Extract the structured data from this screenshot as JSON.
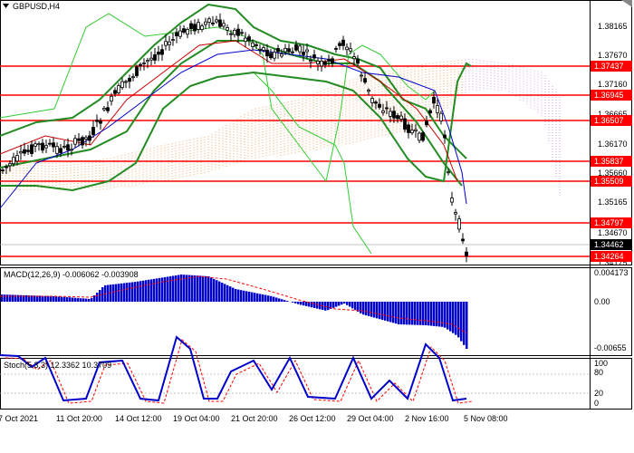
{
  "main_panel": {
    "symbol_title": "GBPUSD,H4",
    "price_labels": [
      "1.38165",
      "1.37670",
      "1.37160",
      "1.36665",
      "1.36170",
      "1.35660",
      "1.35165",
      "1.34670",
      "1.34175"
    ],
    "level_badges": [
      "1.37437",
      "1.36945",
      "1.36507",
      "1.35837",
      "1.35509",
      "1.34797",
      "1.34264"
    ],
    "current_price": "1.34462"
  },
  "macd_panel": {
    "title": "MACD(12,26,9) -0.006062 -0.003908",
    "labels": [
      "0.004173",
      "0.00",
      "-0.00655"
    ],
    "histogram_color": "#0000cc",
    "signal_color": "#ff0000"
  },
  "stoch_panel": {
    "title": "Stoch(5,3,3) 12.3362 10.3709",
    "labels": [
      "100",
      "80",
      "20",
      "0"
    ],
    "main_color": "#0000cc",
    "signal_color": "#ff0000"
  },
  "time_axis": {
    "labels": [
      "7 Oct 2021",
      "11 Oct 20:00",
      "14 Oct 12:00",
      "19 Oct 04:00",
      "21 Oct 20:00",
      "26 Oct 12:00",
      "29 Oct 04:00",
      "2 Nov 16:00",
      "5 Nov 08:00"
    ]
  },
  "colors": {
    "level_line": "#ff0000",
    "bollinger": "#228b22",
    "envelope": "#33cc33",
    "ma_fast": "#cc0000",
    "ma_slow": "#0000cc",
    "cloud_orange": "#f4a460",
    "cloud_violet": "#c9a0dc"
  }
}
